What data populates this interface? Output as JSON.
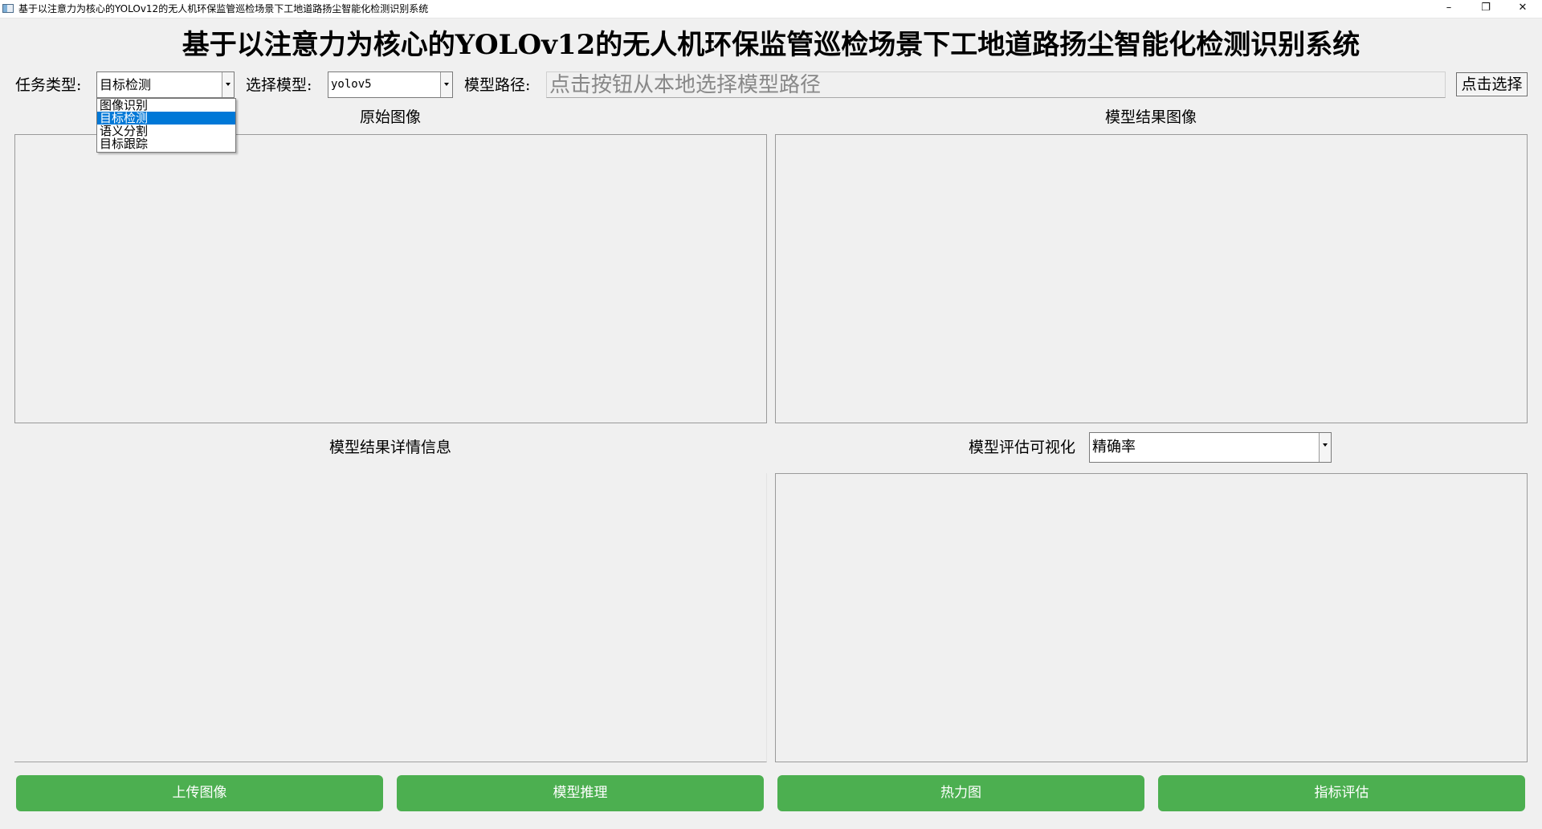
{
  "window": {
    "title": "基于以注意力为核心的YOLOv12的无人机环保监管巡检场景下工地道路扬尘智能化检测识别系统",
    "minimize_glyph": "–",
    "maximize_glyph": "❐",
    "close_glyph": "✕"
  },
  "header": {
    "title": "基于以注意力为核心的YOLOv12的无人机环保监管巡检场景下工地道路扬尘智能化检测识别系统"
  },
  "controls": {
    "task_type_label": "任务类型:",
    "task_type_value": "目标检测",
    "task_type_options": [
      "图像识别",
      "目标检测",
      "语义分割",
      "目标跟踪"
    ],
    "task_type_selected_index": 1,
    "model_label": "选择模型:",
    "model_value": "yolov5",
    "model_path_label": "模型路径:",
    "model_path_placeholder": "点击按钮从本地选择模型路径",
    "select_button": "点击选择"
  },
  "panels": {
    "original_image_label": "原始图像",
    "result_image_label": "模型结果图像",
    "result_details_label": "模型结果详情信息",
    "eval_vis_label": "模型评估可视化",
    "eval_metric_value": "精确率"
  },
  "buttons": {
    "upload": "上传图像",
    "infer": "模型推理",
    "heatmap": "热力图",
    "evaluate": "指标评估"
  },
  "colors": {
    "button_green": "#4caf50",
    "selection_blue": "#0078d7",
    "background": "#f0f0f0"
  }
}
